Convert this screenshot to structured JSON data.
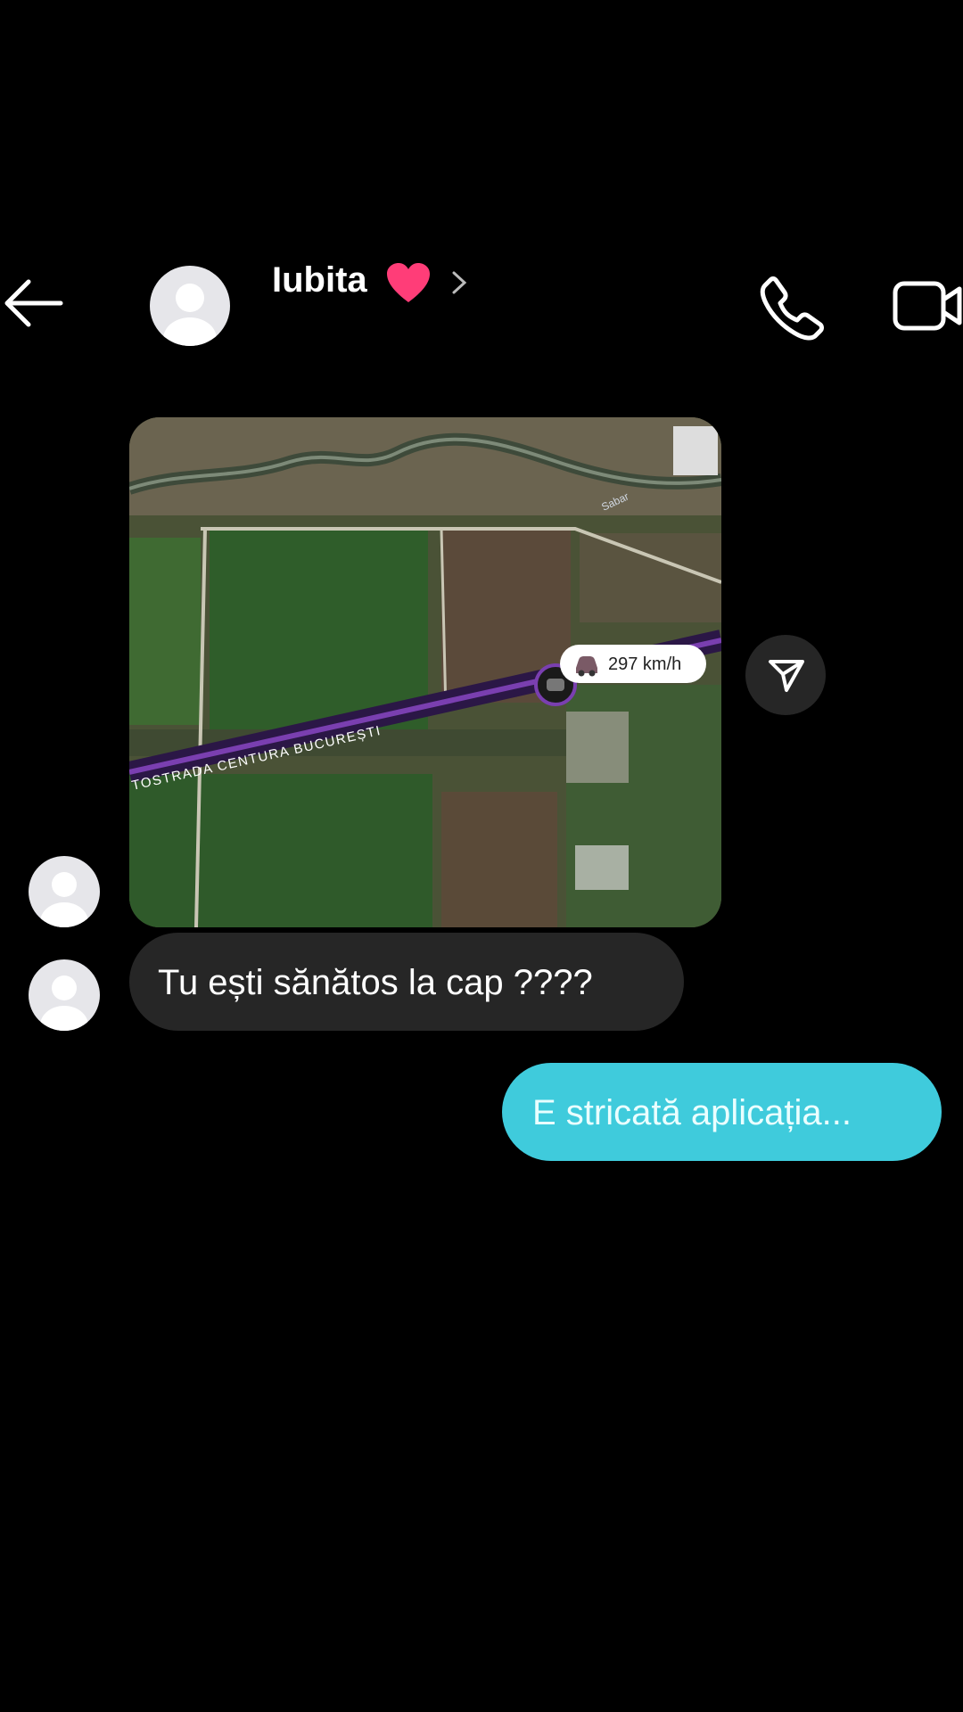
{
  "header": {
    "contact_name": "Iubita",
    "icons": [
      "back-arrow-icon",
      "avatar",
      "heart-icon",
      "chevron-right-icon",
      "phone-icon",
      "video-camera-icon"
    ]
  },
  "map_message": {
    "speed": "297 km/h",
    "road_label": "TOSTRADA CENTURA BUCUREȘTI",
    "river_label": "Sabar"
  },
  "messages": [
    {
      "direction": "incoming",
      "text": "Tu ești sănătos la cap ????"
    },
    {
      "direction": "outgoing",
      "text": "E stricată aplicația..."
    }
  ],
  "colors": {
    "background": "#000000",
    "incoming_bubble": "#262626",
    "outgoing_bubble": "#3fcbdc",
    "heart": "#ff3d78"
  }
}
